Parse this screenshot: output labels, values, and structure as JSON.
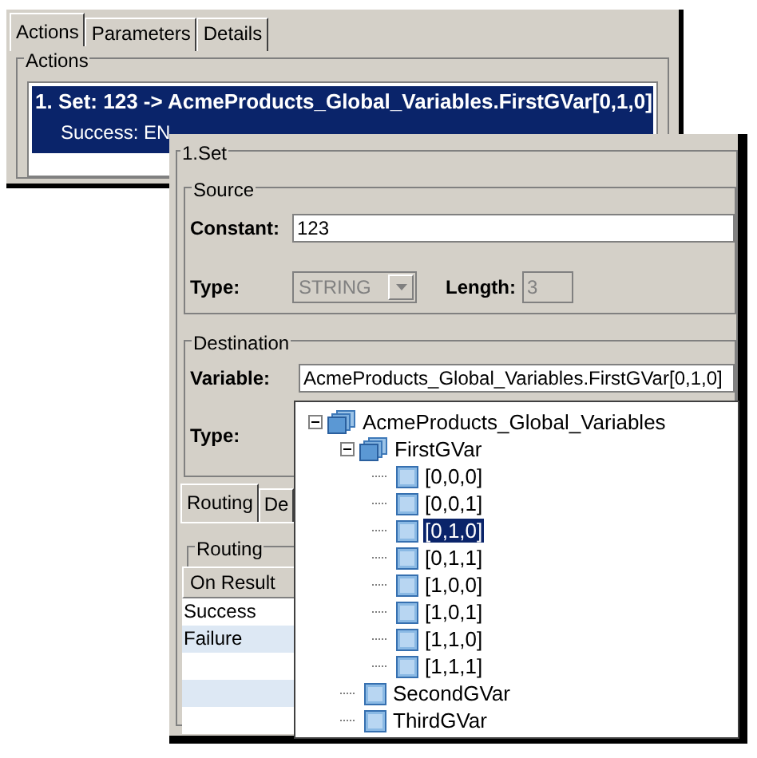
{
  "back_window": {
    "tabs": [
      {
        "label": "Actions",
        "selected": true
      },
      {
        "label": "Parameters",
        "selected": false
      },
      {
        "label": "Details",
        "selected": false
      }
    ],
    "actions_group": {
      "title": "Actions",
      "items": [
        {
          "text": "1. Set: 123 -> AcmeProducts_Global_Variables.FirstGVar[0,1,0]",
          "detail": "Success: EN",
          "selected": true
        }
      ]
    }
  },
  "front_dialog": {
    "title": "1.Set",
    "source": {
      "title": "Source",
      "constant_label": "Constant:",
      "constant_value": "123",
      "type_label": "Type:",
      "type_value": "STRING",
      "type_disabled": true,
      "length_label": "Length:",
      "length_value": "3",
      "length_disabled": true
    },
    "destination": {
      "title": "Destination",
      "variable_label": "Variable:",
      "variable_value": "AcmeProducts_Global_Variables.FirstGVar[0,1,0]",
      "type_label": "Type:"
    },
    "tabs": [
      {
        "label": "Routing",
        "selected": true
      },
      {
        "label": "De",
        "selected": false
      }
    ],
    "routing": {
      "title": "Routing",
      "column": "On Result",
      "rows": [
        "Success",
        "Failure"
      ]
    }
  },
  "tree": [
    {
      "label": "AcmeProducts_Global_Variables",
      "kind": "group",
      "expanded": true,
      "selected": false,
      "children": [
        {
          "label": "FirstGVar",
          "kind": "group",
          "expanded": true,
          "selected": false,
          "children": [
            {
              "label": "[0,0,0]",
              "kind": "leaf",
              "selected": false
            },
            {
              "label": "[0,0,1]",
              "kind": "leaf",
              "selected": false
            },
            {
              "label": "[0,1,0]",
              "kind": "leaf",
              "selected": true
            },
            {
              "label": "[0,1,1]",
              "kind": "leaf",
              "selected": false
            },
            {
              "label": "[1,0,0]",
              "kind": "leaf",
              "selected": false
            },
            {
              "label": "[1,0,1]",
              "kind": "leaf",
              "selected": false
            },
            {
              "label": "[1,1,0]",
              "kind": "leaf",
              "selected": false
            },
            {
              "label": "[1,1,1]",
              "kind": "leaf",
              "selected": false
            }
          ]
        },
        {
          "label": "SecondGVar",
          "kind": "leaf",
          "selected": false
        },
        {
          "label": "ThirdGVar",
          "kind": "leaf",
          "selected": false
        }
      ]
    }
  ]
}
